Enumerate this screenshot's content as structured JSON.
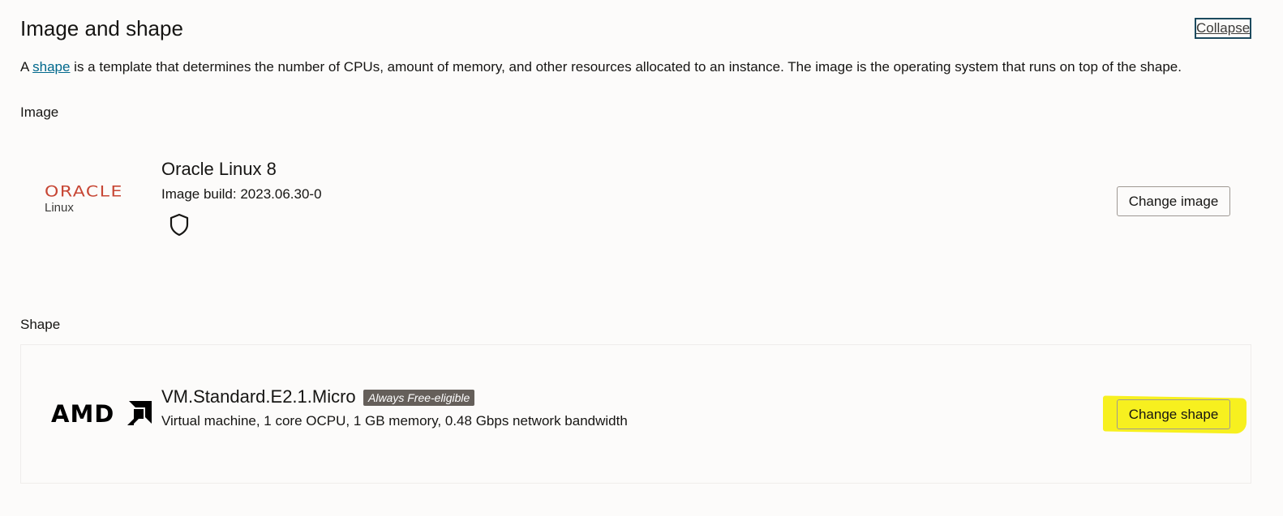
{
  "section": {
    "title": "Image and shape",
    "collapse_label": "Collapse"
  },
  "intro": {
    "prefix": "A ",
    "link_text": "shape",
    "suffix": " is a template that determines the number of CPUs, amount of memory, and other resources allocated to an instance. The image is the operating system that runs on top of the shape."
  },
  "image": {
    "label": "Image",
    "logo_word": "ORACLE",
    "logo_sub": "Linux",
    "name": "Oracle Linux 8",
    "build": "Image build: 2023.06.30-0",
    "icon": "shield-icon",
    "button_label": "Change image"
  },
  "shape": {
    "label": "Shape",
    "logo_word": "AMD",
    "name": "VM.Standard.E2.1.Micro",
    "badge": "Always Free-eligible",
    "description": "Virtual machine, 1 core OCPU, 1 GB memory, 0.48 Gbps network bandwidth",
    "button_label": "Change shape"
  },
  "colors": {
    "oracle_red": "#c74634",
    "link": "#00688c",
    "highlight": "#f7f01f",
    "badge_bg": "#655f5a"
  }
}
